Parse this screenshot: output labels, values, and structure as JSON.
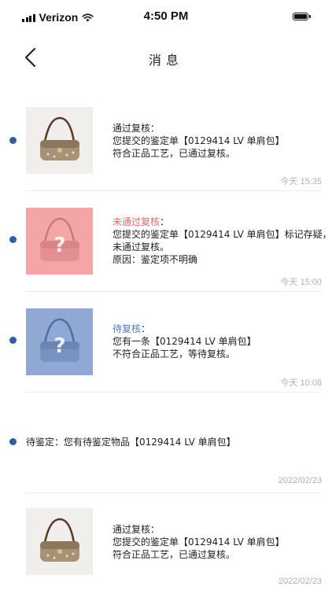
{
  "status_bar": {
    "carrier": "Verizon",
    "time": "4:50 PM"
  },
  "nav": {
    "title": "消息"
  },
  "messages": [
    {
      "status": "通过复核：",
      "lines": [
        "您提交的鉴定单【0129414 LV 单肩包】",
        "符合正品工艺，已通过复核。"
      ],
      "time": "今天 15:35"
    },
    {
      "status": "未通过复核",
      "status_suffix": "：",
      "lines": [
        "您提交的鉴定单【0129414 LV 单肩包】标记存疑，",
        "未通过复核。",
        "原因：鉴定项不明确"
      ],
      "time": "今天 15:00"
    },
    {
      "status": "待复核",
      "status_suffix": "：",
      "lines": [
        "您有一条【0129414 LV 单肩包】",
        "不符合正品工艺，等待复核。"
      ],
      "time": "今天 10:08"
    },
    {
      "text": "待鉴定：您有待鉴定物品【0129414 LV 单肩包】",
      "time": "2022/02/23"
    },
    {
      "status": "通过复核：",
      "lines": [
        "您提交的鉴定单【0129414 LV 单肩包】",
        "符合正品工艺，已通过复核。"
      ],
      "time": "2022/02/23"
    }
  ],
  "colors": {
    "dot": "#2f5ea8",
    "rejected_text": "#e46a6a",
    "pending_text": "#4a7bbf",
    "rejected_bg": "#f4a6a6",
    "pending_bg": "#8fa9d4"
  }
}
